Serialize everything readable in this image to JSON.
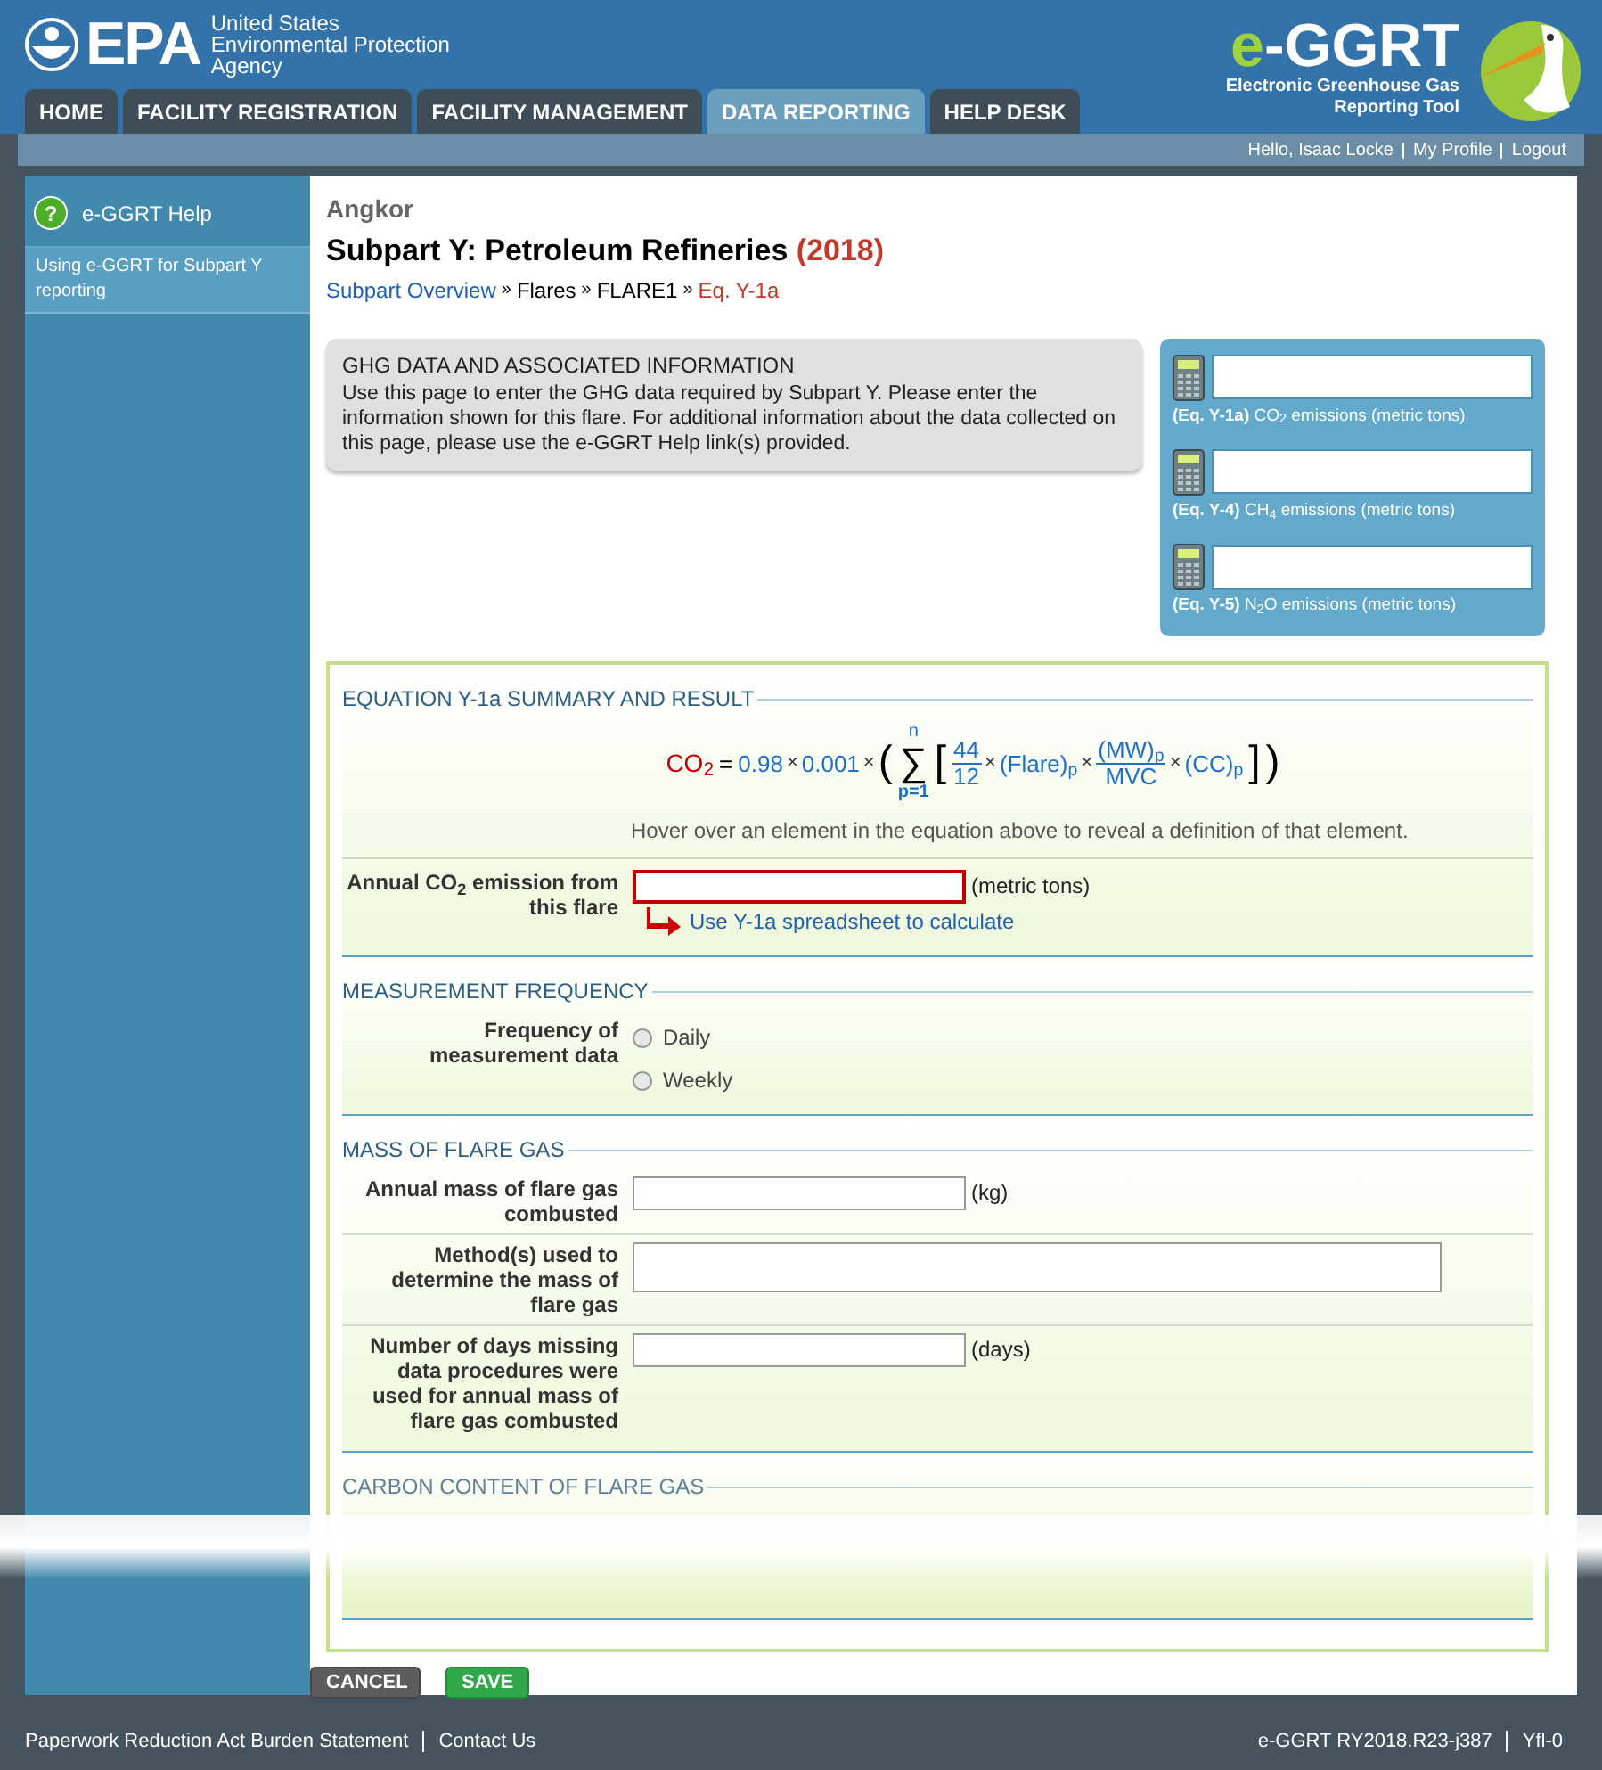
{
  "header": {
    "agency": {
      "logo": "EPA",
      "lines": [
        "United States",
        "Environmental Protection",
        "Agency"
      ]
    },
    "tabs": [
      {
        "label": "HOME",
        "selected": false
      },
      {
        "label": "FACILITY REGISTRATION",
        "selected": false
      },
      {
        "label": "FACILITY MANAGEMENT",
        "selected": false
      },
      {
        "label": "DATA REPORTING",
        "selected": true
      },
      {
        "label": "HELP DESK",
        "selected": false
      }
    ],
    "tool_logo": {
      "prefix": "e",
      "name": "-GGRT",
      "subtitle": [
        "Electronic Greenhouse Gas",
        "Reporting Tool"
      ]
    }
  },
  "user_bar": {
    "greeting": "Hello, Isaac Locke",
    "links": [
      "My Profile",
      "Logout"
    ]
  },
  "sidebar": {
    "help_icon": "?",
    "help_title": "e-GGRT Help",
    "items": [
      "Using e-GGRT for Subpart Y reporting"
    ]
  },
  "page": {
    "facility": "Angkor",
    "title": "Subpart Y: Petroleum Refineries",
    "year": "(2018)",
    "breadcrumb": [
      {
        "label": "Subpart Overview",
        "kind": "link"
      },
      {
        "label": "Flares",
        "kind": "text"
      },
      {
        "label": "FLARE1",
        "kind": "text"
      },
      {
        "label": "Eq. Y-1a",
        "kind": "current"
      }
    ],
    "separator": "»"
  },
  "info_box": {
    "title": "GHG DATA AND ASSOCIATED INFORMATION",
    "text": "Use this page to enter the GHG data required by Subpart Y. Please enter the information shown for this flare. For additional information about the data collected on this page, please use the e-GGRT Help link(s) provided."
  },
  "emissions_panel": [
    {
      "label": "**(Eq. Y-1a)** CO$_{2}$ emissions (metric tons)"
    },
    {
      "label": "**(Eq. Y-4)** CH$_{4}$ emissions (metric tons)"
    },
    {
      "label": "**(Eq. Y-5)** N$_{2}$O emissions (metric tons)"
    }
  ],
  "equation": {
    "lhs": "CO$_{2}$",
    "equals": "=",
    "factor_1": "0.98",
    "factor_2": "0.001",
    "times": "×",
    "open_paren": "(",
    "sum": "∑",
    "sum_upper": "n",
    "sum_lower": "p=1",
    "open_bracket": "[",
    "ratio_num": "44",
    "ratio_den": "12",
    "flare": "(Flare)$_{p}$",
    "mw_num": "(MW)$_{p}$",
    "mw_den": "MVC",
    "cc": "(CC)$_{p}$",
    "close_bracket": "]",
    "close_paren": ")",
    "hint": "Hover over an element in the equation above to reveal a definition of that element."
  },
  "sections": [
    {
      "title": "EQUATION Y-1a SUMMARY AND RESULT",
      "kind": "equation",
      "fields": [
        {
          "kind": "input",
          "label": "Annual CO$_{2}$ emission from this flare",
          "unit": "(metric tons)",
          "invalid": true,
          "link": "Use Y-1a spreadsheet to calculate"
        }
      ]
    },
    {
      "title": "MEASUREMENT FREQUENCY",
      "kind": "fields",
      "fields": [
        {
          "kind": "radio",
          "label": "Frequency of measurement data",
          "options": [
            {
              "label": "Daily",
              "selected": false
            },
            {
              "label": "Weekly",
              "selected": false
            }
          ]
        }
      ]
    },
    {
      "title": "MASS OF FLARE GAS",
      "kind": "fields",
      "fields": [
        {
          "kind": "input",
          "label": "Annual mass of flare gas combusted",
          "unit": "(kg)",
          "invalid": false
        },
        {
          "kind": "textarea",
          "label": "Method(s) used to determine the mass of flare gas"
        },
        {
          "kind": "input",
          "label": "Number of days missing data procedures were used for annual mass of flare gas combusted",
          "unit": "(days)",
          "invalid": false
        }
      ]
    },
    {
      "title": "CARBON CONTENT OF FLARE GAS",
      "kind": "faded"
    }
  ],
  "buttons": [
    {
      "label": "CANCEL",
      "kind": "cancel"
    },
    {
      "label": "SAVE",
      "kind": "save"
    }
  ],
  "footer": {
    "links": [
      "Paperwork Reduction Act Burden Statement",
      "Contact Us"
    ],
    "version": [
      "e-GGRT RY2018.R23-j387",
      "Yfl-0"
    ]
  }
}
